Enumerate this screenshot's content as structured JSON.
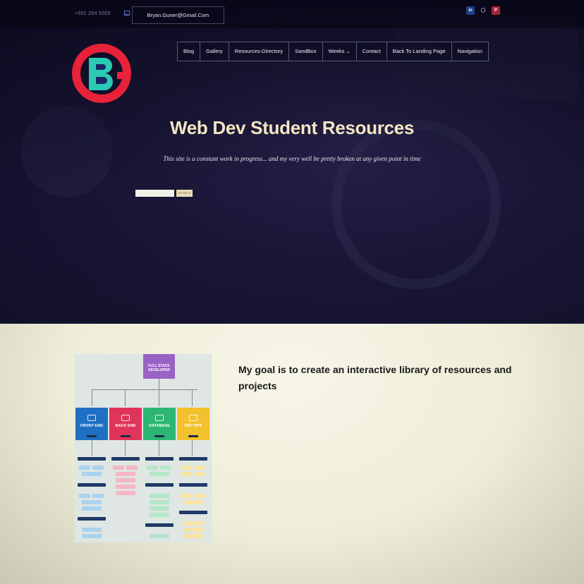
{
  "topbar": {
    "phone": "+551 254 5505",
    "email": "Bryan.Guner@Gmail.Com",
    "social_icons": [
      "linkedin-icon",
      "github-icon",
      "pinterest-icon"
    ]
  },
  "logo": {
    "letters": "BG",
    "colors": {
      "ring": "#e8223a",
      "letter": "#2cc9b5",
      "inner": "#1a2766"
    }
  },
  "nav": {
    "items": [
      {
        "label": "Blog"
      },
      {
        "label": "Gallery"
      },
      {
        "label": "Resources-Directory"
      },
      {
        "label": "SandBox"
      },
      {
        "label": "Weeks ⌄"
      },
      {
        "label": "Contact"
      },
      {
        "label": "Back To Landing Page"
      },
      {
        "label": "Navigation"
      }
    ]
  },
  "hero": {
    "title": "Web Dev Student Resources",
    "subtitle": "This site is a constant work in progress... and my very well be pretty broken at any given point in time",
    "search": {
      "value": "",
      "button_label": "SEARCH"
    }
  },
  "main": {
    "goal_text": "My goal is to create an interactive library of resources and projects"
  },
  "roadmap": {
    "top_label": "FULL STACK DEVELOPER",
    "columns": [
      {
        "label": "FRONT END",
        "color": "#1f6fc4"
      },
      {
        "label": "BACK END",
        "color": "#e0345a"
      },
      {
        "label": "DATABASE",
        "color": "#2bb673"
      },
      {
        "label": "DEV OPS",
        "color": "#f2c12e"
      }
    ]
  },
  "colors": {
    "title": "#f4e6c2",
    "hero_bg": "#1a1638",
    "lower_bg": "#f2f1e2"
  }
}
